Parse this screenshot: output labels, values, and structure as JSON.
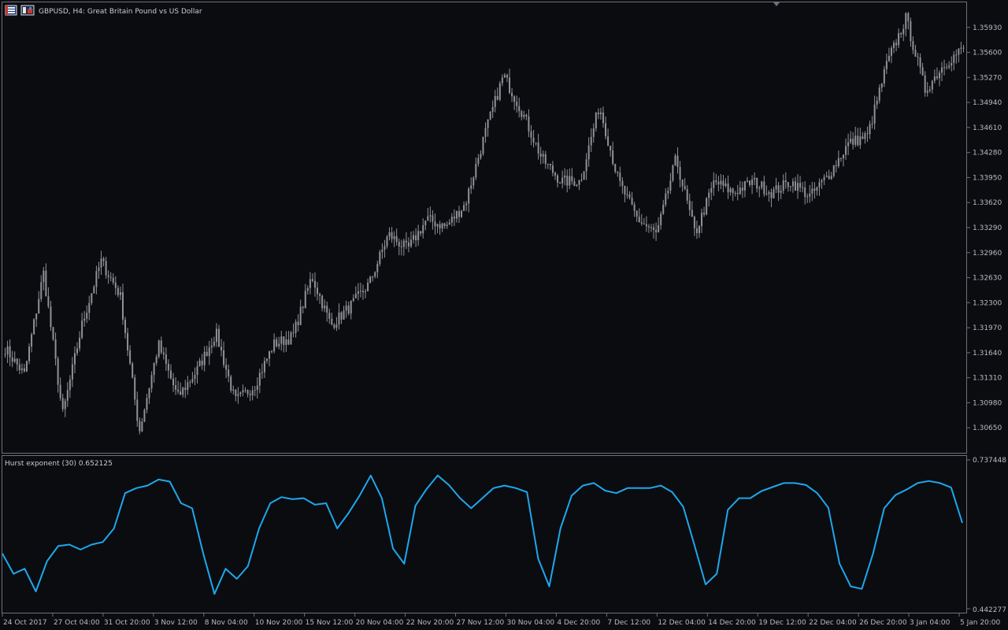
{
  "header": {
    "symbol_line": "GBPUSD, H4:  Great Britain Pound vs US Dollar",
    "icons": [
      "window-list-icon",
      "chart-properties-icon"
    ]
  },
  "indicator": {
    "label": "Hurst exponent (30) 0.652125",
    "max_label": "0.737448",
    "min_label": "0.442277"
  },
  "colors": {
    "background": "#0b0c10",
    "candle": "#8f9297",
    "hurst_line": "#1ea7ec",
    "border": "#6e7178",
    "text": "#b8bcc4"
  },
  "chart_data": [
    {
      "type": "candlestick",
      "title": "GBPUSD, H4:  Great Britain Pound vs US Dollar",
      "ylim": [
        1.3032,
        1.3626
      ],
      "y_ticks": [
        "1.35930",
        "1.35600",
        "1.35270",
        "1.34940",
        "1.34610",
        "1.34280",
        "1.33950",
        "1.33620",
        "1.33290",
        "1.32960",
        "1.32630",
        "1.32300",
        "1.31970",
        "1.31640",
        "1.31310",
        "1.30980",
        "1.30650"
      ],
      "x_ticks": [
        "24 Oct 2017",
        "27 Oct 04:00",
        "31 Oct 20:00",
        "3 Nov 12:00",
        "8 Nov 04:00",
        "10 Nov 20:00",
        "15 Nov 12:00",
        "20 Nov 04:00",
        "22 Nov 20:00",
        "27 Nov 12:00",
        "30 Nov 04:00",
        "4 Dec 20:00",
        "7 Dec 12:00",
        "12 Dec 04:00",
        "14 Dec 20:00",
        "19 Dec 12:00",
        "22 Dec 04:00",
        "26 Dec 20:00",
        "3 Jan 04:00",
        "5 Jan 20:00"
      ],
      "close_anchors": [
        {
          "x": "24 Oct 2017",
          "y": 1.317
        },
        {
          "x": "25 Oct 2017",
          "y": 1.3135
        },
        {
          "x": "26 Oct 2017",
          "y": 1.327
        },
        {
          "x": "27 Oct 04:00",
          "y": 1.3082
        },
        {
          "x": "30 Oct 2017",
          "y": 1.32
        },
        {
          "x": "31 Oct 20:00",
          "y": 1.3285
        },
        {
          "x": "1 Nov 2017",
          "y": 1.324
        },
        {
          "x": "3 Nov 12:00",
          "y": 1.306
        },
        {
          "x": "6 Nov 2017",
          "y": 1.3175
        },
        {
          "x": "7 Nov 2017",
          "y": 1.3105
        },
        {
          "x": "8 Nov 04:00",
          "y": 1.314
        },
        {
          "x": "9 Nov 2017",
          "y": 1.319
        },
        {
          "x": "10 Nov 20:00",
          "y": 1.31
        },
        {
          "x": "13 Nov 2017",
          "y": 1.312
        },
        {
          "x": "14 Nov 2017",
          "y": 1.3175
        },
        {
          "x": "15 Nov 12:00",
          "y": 1.3185
        },
        {
          "x": "16 Nov 2017",
          "y": 1.3265
        },
        {
          "x": "17 Nov 2017",
          "y": 1.32
        },
        {
          "x": "20 Nov 04:00",
          "y": 1.3225
        },
        {
          "x": "21 Nov 2017",
          "y": 1.3255
        },
        {
          "x": "22 Nov 20:00",
          "y": 1.332
        },
        {
          "x": "23 Nov 2017",
          "y": 1.33
        },
        {
          "x": "24 Nov 2017",
          "y": 1.334
        },
        {
          "x": "27 Nov 12:00",
          "y": 1.333
        },
        {
          "x": "28 Nov 2017",
          "y": 1.336
        },
        {
          "x": "29 Nov 2017",
          "y": 1.345
        },
        {
          "x": "30 Nov 04:00",
          "y": 1.353
        },
        {
          "x": "1 Dec 2017",
          "y": 1.348
        },
        {
          "x": "4 Dec 20:00",
          "y": 1.342
        },
        {
          "x": "5 Dec 2017",
          "y": 1.339
        },
        {
          "x": "6 Dec 2017",
          "y": 1.339
        },
        {
          "x": "7 Dec 12:00",
          "y": 1.349
        },
        {
          "x": "8 Dec 2017",
          "y": 1.339
        },
        {
          "x": "11 Dec 2017",
          "y": 1.334
        },
        {
          "x": "12 Dec 04:00",
          "y": 1.332
        },
        {
          "x": "13 Dec 2017",
          "y": 1.342
        },
        {
          "x": "14 Dec 20:00",
          "y": 1.332
        },
        {
          "x": "15 Dec 2017",
          "y": 1.339
        },
        {
          "x": "18 Dec 2017",
          "y": 1.3375
        },
        {
          "x": "19 Dec 12:00",
          "y": 1.339
        },
        {
          "x": "20 Dec 2017",
          "y": 1.3375
        },
        {
          "x": "21 Dec 2017",
          "y": 1.339
        },
        {
          "x": "22 Dec 04:00",
          "y": 1.337
        },
        {
          "x": "26 Dec 2017",
          "y": 1.34
        },
        {
          "x": "27 Dec 2017",
          "y": 1.344
        },
        {
          "x": "26 Dec 20:00",
          "y": 1.345
        },
        {
          "x": "28 Dec 2017",
          "y": 1.3545
        },
        {
          "x": "2 Jan 2018",
          "y": 1.3605
        },
        {
          "x": "3 Jan 04:00",
          "y": 1.351
        },
        {
          "x": "4 Jan 2018",
          "y": 1.3545
        },
        {
          "x": "5 Jan 20:00",
          "y": 1.3565
        }
      ]
    },
    {
      "type": "line",
      "title": "Hurst exponent (30) 0.652125",
      "ylim": [
        0.442277,
        0.737448
      ],
      "series": [
        {
          "values": [
            0.55,
            0.51,
            0.52,
            0.475,
            0.535,
            0.565,
            0.568,
            0.558,
            0.568,
            0.573,
            0.6,
            0.67,
            0.68,
            0.685,
            0.697,
            0.693,
            0.65,
            0.64,
            0.55,
            0.47,
            0.52,
            0.5,
            0.525,
            0.6,
            0.65,
            0.662,
            0.658,
            0.66,
            0.647,
            0.65,
            0.6,
            0.63,
            0.665,
            0.705,
            0.66,
            0.56,
            0.53,
            0.645,
            0.678,
            0.705,
            0.686,
            0.66,
            0.64,
            0.66,
            0.68,
            0.685,
            0.68,
            0.672,
            0.54,
            0.485,
            0.6,
            0.665,
            0.685,
            0.69,
            0.675,
            0.67,
            0.68,
            0.68,
            0.68,
            0.685,
            0.672,
            0.643,
            0.567,
            0.489,
            0.51,
            0.637,
            0.66,
            0.66,
            0.674,
            0.682,
            0.69,
            0.69,
            0.686,
            0.67,
            0.641,
            0.53,
            0.485,
            0.48,
            0.55,
            0.64,
            0.666,
            0.677,
            0.69,
            0.694,
            0.69,
            0.681,
            0.611
          ]
        }
      ]
    }
  ]
}
